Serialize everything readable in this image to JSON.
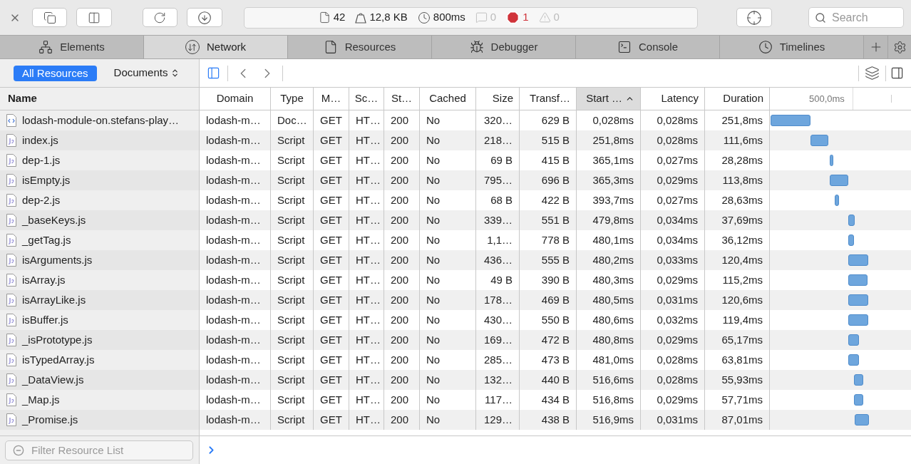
{
  "toolbar": {
    "stats": [
      {
        "kind": "resources",
        "value": "42"
      },
      {
        "kind": "size",
        "value": "12,8 KB"
      },
      {
        "kind": "time",
        "value": "800ms"
      },
      {
        "kind": "messages",
        "value": "0"
      },
      {
        "kind": "errors",
        "value": "1"
      },
      {
        "kind": "warnings",
        "value": "0"
      }
    ],
    "search": {
      "placeholder": "Search"
    }
  },
  "tabs": [
    {
      "kind": "elements",
      "label": "Elements",
      "selected": false
    },
    {
      "kind": "network",
      "label": "Network",
      "selected": true
    },
    {
      "kind": "resources",
      "label": "Resources",
      "selected": false
    },
    {
      "kind": "debugger",
      "label": "Debugger",
      "selected": false
    },
    {
      "kind": "console",
      "label": "Console",
      "selected": false
    },
    {
      "kind": "timelines",
      "label": "Timelines",
      "selected": false
    }
  ],
  "filter_bar": {
    "scopes": [
      {
        "kind": "toggle",
        "label": "All Resources",
        "selected": true
      },
      {
        "kind": "popup",
        "label": "Documents",
        "selected": false
      }
    ]
  },
  "table": {
    "name_column": "Name",
    "columns": [
      {
        "label": "Domain",
        "sorted": false
      },
      {
        "label": "Type",
        "sorted": false
      },
      {
        "label": "M…",
        "sorted": false
      },
      {
        "label": "Sc…",
        "sorted": false
      },
      {
        "label": "St…",
        "sorted": false
      },
      {
        "label": "Cached",
        "sorted": false
      },
      {
        "label": "Size",
        "sorted": false
      },
      {
        "label": "Transf…",
        "sorted": false
      },
      {
        "label": "Start …",
        "sorted": true
      },
      {
        "label": "Latency",
        "sorted": false
      },
      {
        "label": "Duration",
        "sorted": false
      }
    ],
    "timeline_label": "500,0ms",
    "rows": [
      {
        "kind": "document",
        "name": "lodash-module-on.stefans-play…",
        "cells": [
          "lodash-m…",
          "Doc…",
          "GET",
          "HT…",
          "200",
          "No",
          "320…",
          "629 B",
          "0,028ms",
          "0,028ms",
          "251,8ms"
        ]
      },
      {
        "kind": "script",
        "name": "index.js",
        "cells": [
          "lodash-m…",
          "Script",
          "GET",
          "HT…",
          "200",
          "No",
          "218…",
          "515 B",
          "251,8ms",
          "0,028ms",
          "111,6ms"
        ]
      },
      {
        "kind": "script",
        "name": "dep-1.js",
        "cells": [
          "lodash-m…",
          "Script",
          "GET",
          "HT…",
          "200",
          "No",
          "69 B",
          "415 B",
          "365,1ms",
          "0,027ms",
          "28,28ms"
        ]
      },
      {
        "kind": "script",
        "name": "isEmpty.js",
        "cells": [
          "lodash-m…",
          "Script",
          "GET",
          "HT…",
          "200",
          "No",
          "795…",
          "696 B",
          "365,3ms",
          "0,029ms",
          "113,8ms"
        ]
      },
      {
        "kind": "script",
        "name": "dep-2.js",
        "cells": [
          "lodash-m…",
          "Script",
          "GET",
          "HT…",
          "200",
          "No",
          "68 B",
          "422 B",
          "393,7ms",
          "0,027ms",
          "28,63ms"
        ]
      },
      {
        "kind": "script",
        "name": "_baseKeys.js",
        "cells": [
          "lodash-m…",
          "Script",
          "GET",
          "HT…",
          "200",
          "No",
          "339…",
          "551 B",
          "479,8ms",
          "0,034ms",
          "37,69ms"
        ]
      },
      {
        "kind": "script",
        "name": "_getTag.js",
        "cells": [
          "lodash-m…",
          "Script",
          "GET",
          "HT…",
          "200",
          "No",
          "1,1…",
          "778 B",
          "480,1ms",
          "0,034ms",
          "36,12ms"
        ]
      },
      {
        "kind": "script",
        "name": "isArguments.js",
        "cells": [
          "lodash-m…",
          "Script",
          "GET",
          "HT…",
          "200",
          "No",
          "436…",
          "555 B",
          "480,2ms",
          "0,033ms",
          "120,4ms"
        ]
      },
      {
        "kind": "script",
        "name": "isArray.js",
        "cells": [
          "lodash-m…",
          "Script",
          "GET",
          "HT…",
          "200",
          "No",
          "49 B",
          "390 B",
          "480,3ms",
          "0,029ms",
          "115,2ms"
        ]
      },
      {
        "kind": "script",
        "name": "isArrayLike.js",
        "cells": [
          "lodash-m…",
          "Script",
          "GET",
          "HT…",
          "200",
          "No",
          "178…",
          "469 B",
          "480,5ms",
          "0,031ms",
          "120,6ms"
        ]
      },
      {
        "kind": "script",
        "name": "isBuffer.js",
        "cells": [
          "lodash-m…",
          "Script",
          "GET",
          "HT…",
          "200",
          "No",
          "430…",
          "550 B",
          "480,6ms",
          "0,032ms",
          "119,4ms"
        ]
      },
      {
        "kind": "script",
        "name": "_isPrototype.js",
        "cells": [
          "lodash-m…",
          "Script",
          "GET",
          "HT…",
          "200",
          "No",
          "169…",
          "472 B",
          "480,8ms",
          "0,029ms",
          "65,17ms"
        ]
      },
      {
        "kind": "script",
        "name": "isTypedArray.js",
        "cells": [
          "lodash-m…",
          "Script",
          "GET",
          "HT…",
          "200",
          "No",
          "285…",
          "473 B",
          "481,0ms",
          "0,028ms",
          "63,81ms"
        ]
      },
      {
        "kind": "script",
        "name": "_DataView.js",
        "cells": [
          "lodash-m…",
          "Script",
          "GET",
          "HT…",
          "200",
          "No",
          "132…",
          "440 B",
          "516,6ms",
          "0,028ms",
          "55,93ms"
        ]
      },
      {
        "kind": "script",
        "name": "_Map.js",
        "cells": [
          "lodash-m…",
          "Script",
          "GET",
          "HT…",
          "200",
          "No",
          "117…",
          "434 B",
          "516,8ms",
          "0,029ms",
          "57,71ms"
        ]
      },
      {
        "kind": "script",
        "name": "_Promise.js",
        "cells": [
          "lodash-m…",
          "Script",
          "GET",
          "HT…",
          "200",
          "No",
          "129…",
          "438 B",
          "516,9ms",
          "0,031ms",
          "87,01ms"
        ]
      }
    ]
  },
  "footer": {
    "filter": {
      "placeholder": "Filter Resource List"
    }
  }
}
